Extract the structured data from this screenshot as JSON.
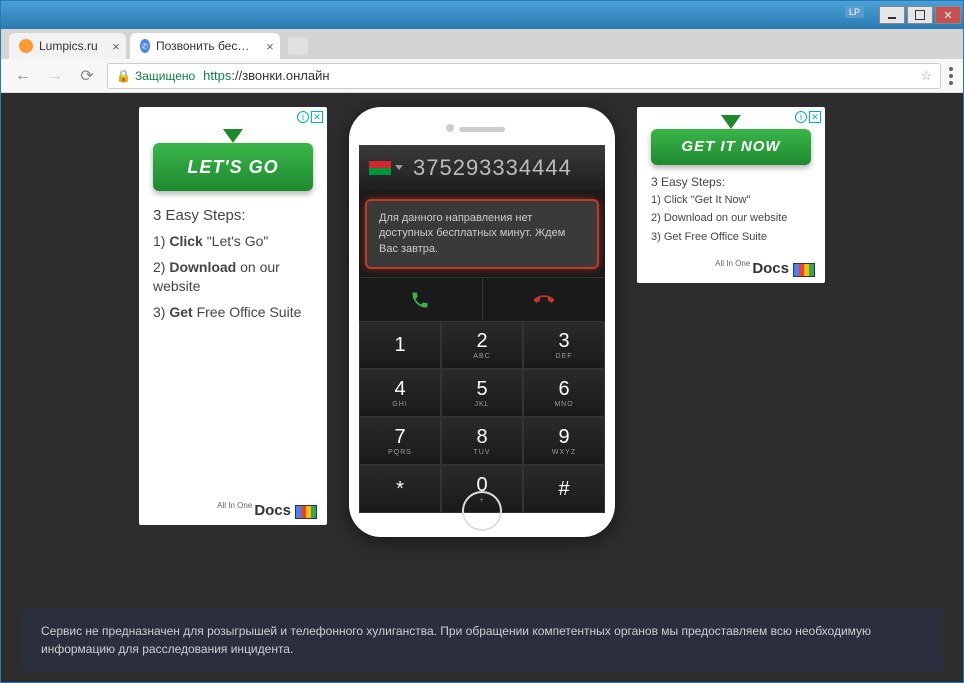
{
  "window": {
    "lp": "LP"
  },
  "tabs": [
    {
      "label": "Lumpics.ru"
    },
    {
      "label": "Позвонить бесплатно д"
    }
  ],
  "url": {
    "secure_label": "Защищено",
    "https": "https",
    "domain": "://звонки.онлайн"
  },
  "ad_left": {
    "button": "LET'S GO",
    "steps_title": "3 Easy Steps:",
    "step1_pre": "1) ",
    "step1_b": "Click",
    "step1_post": " \"Let's Go\"",
    "step2_pre": "2) ",
    "step2_b": "Download",
    "step2_post": " on our website",
    "step3_pre": "3) ",
    "step3_b": "Get",
    "step3_post": " Free Office Suite",
    "logo_small": "All In One",
    "logo": "Docs"
  },
  "ad_right": {
    "button": "GET IT NOW",
    "steps_title": "3 Easy Steps:",
    "step1": "1) Click \"Get It Now\"",
    "step2": "2) Download on our website",
    "step3": "3) Get Free Office Suite",
    "logo_small": "All In One",
    "logo": "Docs"
  },
  "phone": {
    "number": "375293334444",
    "message": "Для данного направления нет доступных бесплатных минут. Ждем Вас завтра.",
    "keys": [
      {
        "n": "1",
        "s": ""
      },
      {
        "n": "2",
        "s": "ABC"
      },
      {
        "n": "3",
        "s": "DEF"
      },
      {
        "n": "4",
        "s": "GHI"
      },
      {
        "n": "5",
        "s": "JKL"
      },
      {
        "n": "6",
        "s": "MNO"
      },
      {
        "n": "7",
        "s": "PQRS"
      },
      {
        "n": "8",
        "s": "TUV"
      },
      {
        "n": "9",
        "s": "WXYZ"
      },
      {
        "n": "*",
        "s": ""
      },
      {
        "n": "0",
        "s": "+"
      },
      {
        "n": "#",
        "s": ""
      }
    ]
  },
  "footer": "Сервис не предназначен для розыгрышей и телефонного хулиганства. При обращении компетентных органов мы предоставляем всю необходимую информацию для расследования инцидента."
}
